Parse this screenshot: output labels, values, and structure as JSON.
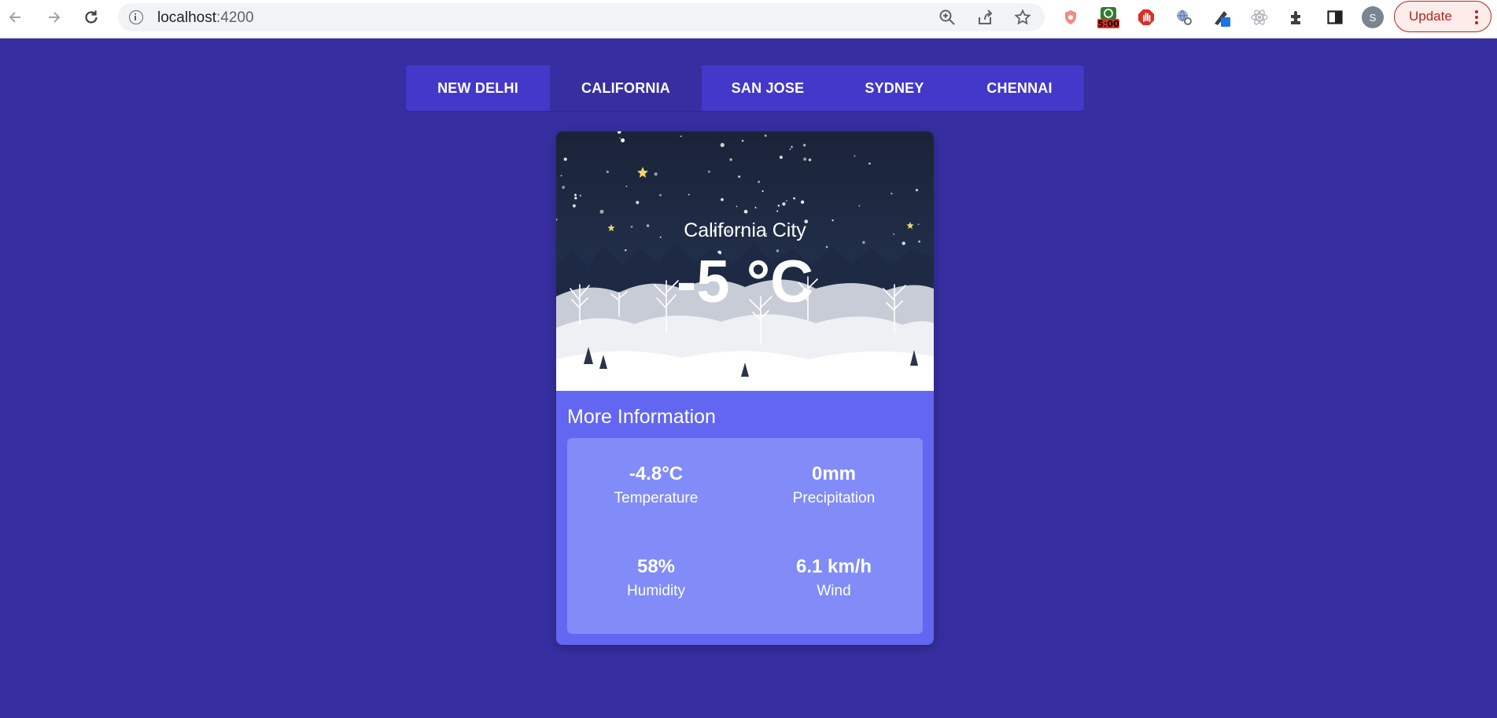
{
  "browser": {
    "url_host": "localhost",
    "url_port": ":4200",
    "timer_badge": "5:00",
    "profile_initial": "S",
    "update_label": "Update"
  },
  "tabs": [
    {
      "label": "NEW DELHI",
      "active": false
    },
    {
      "label": "CALIFORNIA",
      "active": true
    },
    {
      "label": "SAN JOSE",
      "active": false
    },
    {
      "label": "SYDNEY",
      "active": false
    },
    {
      "label": "CHENNAI",
      "active": false
    }
  ],
  "weather": {
    "city": "California City",
    "temperature": "-5 °C"
  },
  "more_info": {
    "title": "More Information",
    "stats": [
      {
        "value": "-4.8°C",
        "label": "Temperature"
      },
      {
        "value": "0mm",
        "label": "Precipitation"
      },
      {
        "value": "58%",
        "label": "Humidity"
      },
      {
        "value": "6.1 km/h",
        "label": "Wind"
      }
    ]
  },
  "colors": {
    "page_bg": "#372fa1",
    "tab_bar": "#4338ca",
    "tab_active": "#372fa1",
    "card_bg": "#6366f1",
    "stats_bg": "#818cf8",
    "night_sky": "#1e2a45"
  }
}
